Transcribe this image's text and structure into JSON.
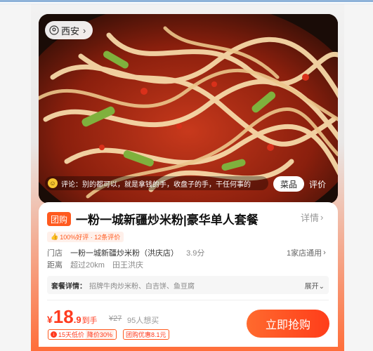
{
  "location": {
    "city": "西安"
  },
  "review_snippet": "评论：别的都可以，就是拿钱的手，收盘子的手，干任何事的",
  "hero_tabs": {
    "dish": "菜品",
    "reviews": "评价"
  },
  "product": {
    "tag": "团购",
    "title": "一粉一城新疆炒米粉|豪华单人套餐",
    "detail_label": "详情",
    "rating_badge": "100%好评 · 12条评价"
  },
  "store": {
    "label": "门店",
    "name": "一粉一城新疆炒米粉（洪庆店）",
    "score": "3.9分",
    "stores_link": "1家店通用"
  },
  "distance": {
    "label": "距离",
    "value": "超过20km",
    "area": "田王洪庆"
  },
  "package": {
    "label": "套餐详情：",
    "items": "招牌牛肉炒米粉、白吉饼、鱼豆腐",
    "expand_label": "展开"
  },
  "price": {
    "currency": "¥",
    "integer": "18",
    "decimal": ".9",
    "suffix": "到手",
    "original": "¥27",
    "wants": "95人想买"
  },
  "badges": {
    "low_price": "15天低价",
    "drop": "降价30%",
    "coupon": "团购优惠8.1元"
  },
  "buy_button": "立即抢购",
  "colors": {
    "accent": "#ff3b1f",
    "accent_light": "#ff6a2e"
  }
}
